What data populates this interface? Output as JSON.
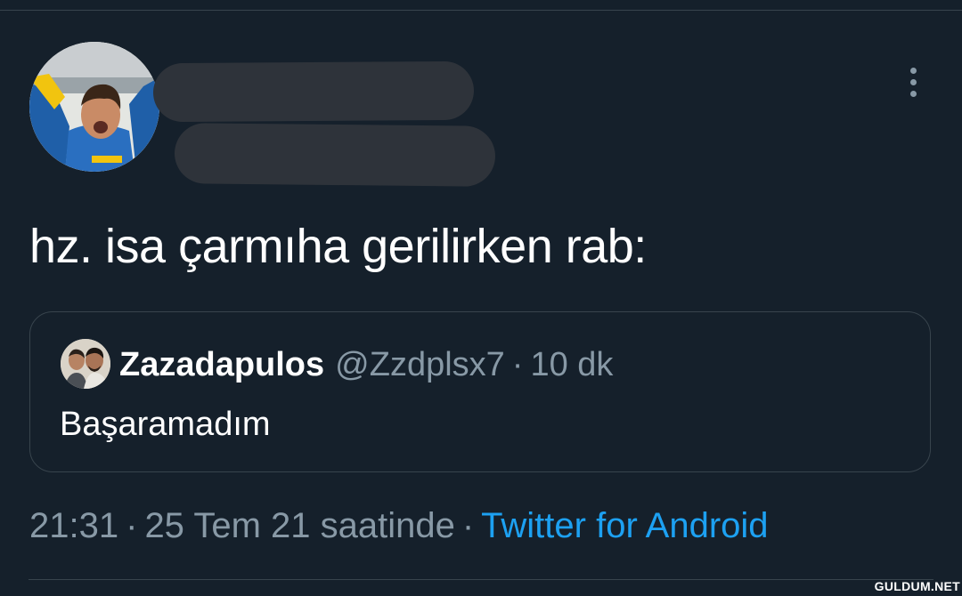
{
  "tweet": {
    "text": "hz. isa çarmıha gerilirken rab:",
    "timestamp": "21:31",
    "date": "25 Tem 21 saatinde",
    "source": "Twitter for Android",
    "separator": "·"
  },
  "quoted_tweet": {
    "display_name": "Zazadapulos",
    "handle": "@Zzdplsx7",
    "separator": "·",
    "age": "10 dk",
    "text": "Başaramadım"
  },
  "watermark": "GULDUM.NET",
  "colors": {
    "background": "#15202b",
    "border": "#38444d",
    "text_primary": "#ffffff",
    "text_secondary": "#8899a6",
    "link": "#1da1f2",
    "redaction": "#2e333a"
  },
  "icons": {
    "menu": "more-vertical-icon"
  }
}
